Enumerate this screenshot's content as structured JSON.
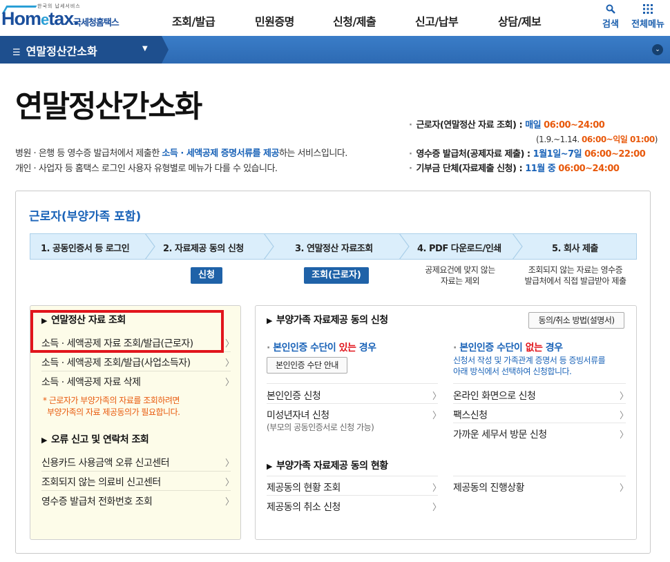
{
  "header": {
    "logo_small": "한국의 납세서비스",
    "logo_brand_pre": "Hom",
    "logo_brand_e": "e",
    "logo_brand_post": "tax.",
    "logo_sub": "국세청홈택스",
    "menu": [
      "조회/발급",
      "민원증명",
      "신청/제출",
      "신고/납부",
      "상담/제보"
    ],
    "search_label": "검색",
    "allmenu_label": "전체메뉴"
  },
  "bar": {
    "title": "연말정산간소화"
  },
  "page": {
    "title": "연말정산간소화",
    "desc_line1_pre": "병원 · 은행 등 영수증 발급처에서 제출한 ",
    "desc_line1_hl": "소득 · 세액공제 증명서류를 제공",
    "desc_line1_post": "하는 서비스입니다.",
    "desc_line2": "개인 · 사업자 등 홈택스 로그인 사용자 유형별로 메뉴가 다를 수 있습니다."
  },
  "schedule": {
    "row1_label": "근로자(연말정산 자료 조회) : ",
    "row1_blue": "매일 ",
    "row1_orange": "06:00~24:00",
    "row1_sub_pre": "(1.9.~1.14. ",
    "row1_sub_orange": "06:00~익일 01:00",
    "row1_sub_post": ")",
    "row2_label": "영수증 발급처(공제자료 제출) : ",
    "row2_blue": "1월1일~7일 ",
    "row2_orange": "06:00~22:00",
    "row3_label": "기부금 단체(자료제출 신청) : ",
    "row3_blue": "11월 중 ",
    "row3_orange": "06:00~24:00"
  },
  "section": {
    "title": "근로자(부양가족 포함)",
    "steps": [
      "1. 공동인증서 등 로그인",
      "2. 자료제공 동의 신청",
      "3. 연말정산 자료조회",
      "4. PDF 다운로드/인쇄",
      "5. 회사 제출"
    ],
    "apply_button": "신청",
    "lookup_button": "조회(근로자)",
    "note4_line1": "공제요건에 맞지 않는",
    "note4_line2": "자료는 제외",
    "note5_line1": "조회되지 않는 자료는 영수증",
    "note5_line2": "발급처에서 직접 발급받아 제출"
  },
  "left_panel": {
    "heading1": "연말정산 자료 조회",
    "items1": [
      "소득 · 세액공제 자료 조회/발급(근로자)",
      "소득 · 세액공제 조회/발급(사업소득자)",
      "소득 · 세액공제 자료 삭제"
    ],
    "warn_line1": "* 근로자가 부양가족의 자료를 조회하려면",
    "warn_line2": "부양가족의 자료 제공동의가 필요합니다.",
    "heading2": "오류 신고 및 연락처 조회",
    "items2": [
      "신용카드 사용금액 오류 신고센터",
      "조회되지 않는 의료비 신고센터",
      "영수증 발급처 전화번호 조회"
    ]
  },
  "right_panel": {
    "heading1": "부양가족 자료제공 동의 신청",
    "guide_button": "동의/취소 방법(설명서)",
    "has_auth_pre": "본인인증 수단이 ",
    "has_auth_red": "있는",
    "has_auth_post": " 경우",
    "auth_guide_button": "본인인증 수단 안내",
    "no_auth_pre": "본인인증 수단이 ",
    "no_auth_red": "없는",
    "no_auth_post": " 경우",
    "no_auth_desc1": "신청서 작성 및 가족관계 증명서 등 증빙서류를",
    "no_auth_desc2": "아래 방식에서 선택하여 신청합니다.",
    "left_items": [
      "본인인증 신청",
      "미성년자녀 신청"
    ],
    "minor_sub": "(부모의 공동인증서로 신청 가능)",
    "right_items": [
      "온라인 화면으로 신청",
      "팩스신청",
      "가까운 세무서 방문 신청"
    ],
    "heading2": "부양가족 자료제공 동의 현황",
    "status_left": [
      "제공동의 현황 조회",
      "제공동의 취소 신청"
    ],
    "status_right": [
      "제공동의 진행상황"
    ]
  }
}
